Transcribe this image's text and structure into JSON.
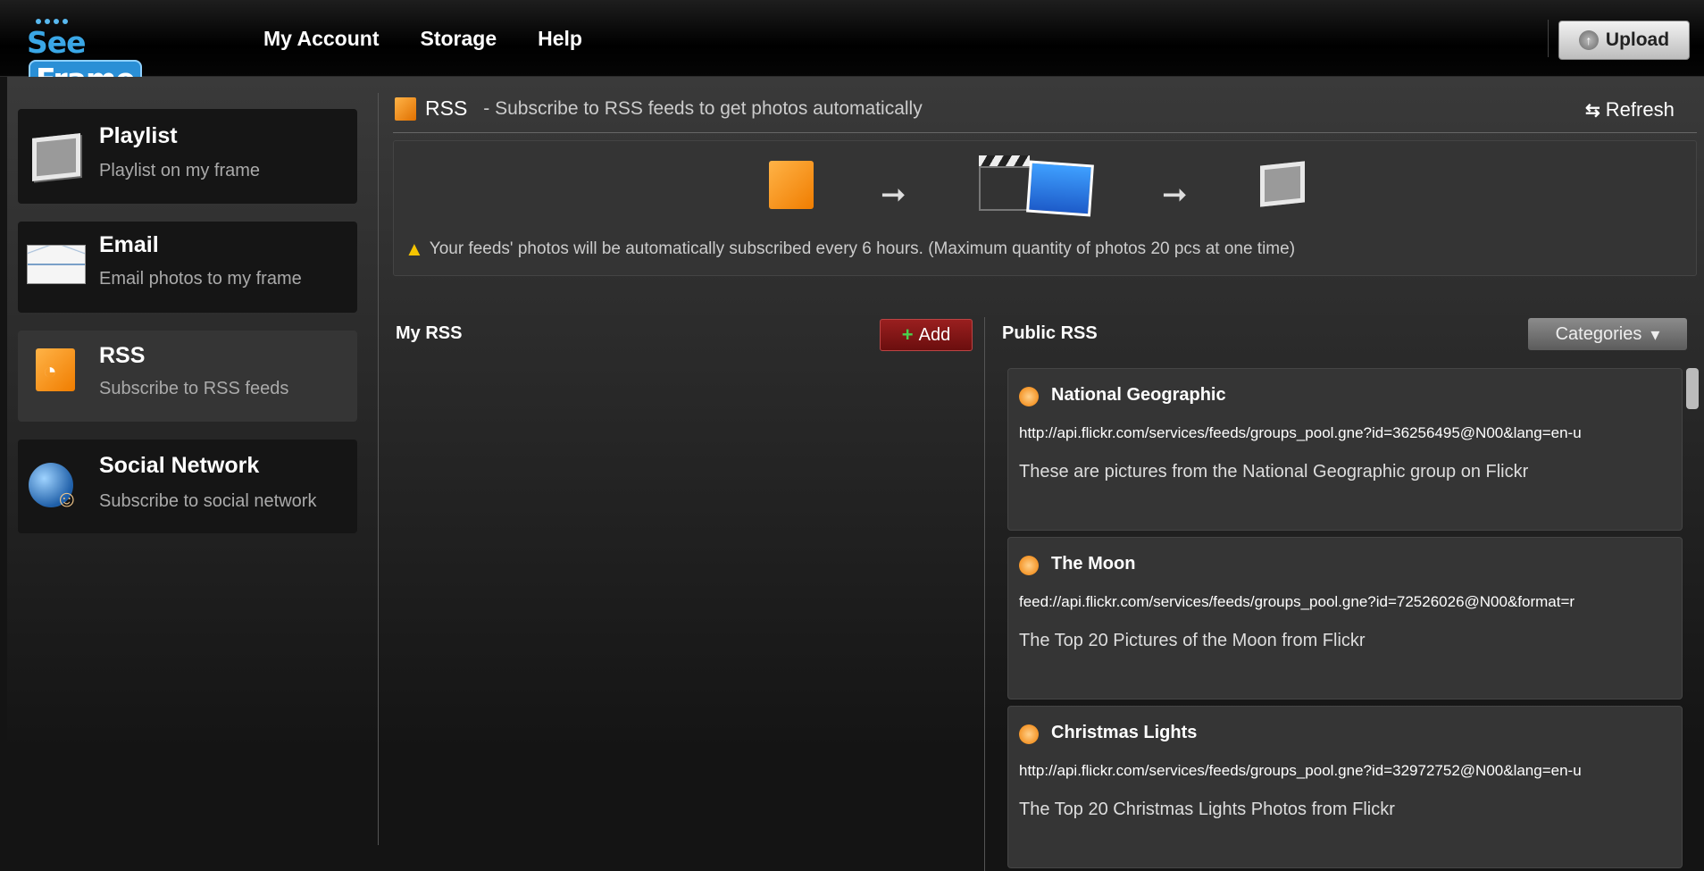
{
  "app": {
    "logo": "SeeFrame",
    "nav": [
      "My Account",
      "Storage",
      "Help"
    ],
    "upload_label": "Upload"
  },
  "sidebar": {
    "items": [
      {
        "title": "Playlist",
        "subtitle": "Playlist on my frame",
        "icon": "photo-frame-icon"
      },
      {
        "title": "Email",
        "subtitle": "Email photos to my frame",
        "icon": "envelope-icon"
      },
      {
        "title": "RSS",
        "subtitle": "Subscribe to RSS feeds",
        "icon": "rss-icon",
        "active": true
      },
      {
        "title": "Social Network",
        "subtitle": "Subscribe to social network",
        "icon": "globe-people-icon"
      }
    ]
  },
  "header": {
    "title": "RSS",
    "subtitle": "- Subscribe to RSS feeds to get photos automatically",
    "refresh_label": "Refresh"
  },
  "info": {
    "warning": "Your feeds' photos will be automatically subscribed every 6 hours. (Maximum quantity of photos 20 pcs at one time)"
  },
  "my_rss": {
    "title": "My RSS",
    "add_label": "Add"
  },
  "public_rss": {
    "title": "Public RSS",
    "categories_label": "Categories",
    "feeds": [
      {
        "title": "National Geographic",
        "url": "http://api.flickr.com/services/feeds/groups_pool.gne?id=36256495@N00&lang=en-u",
        "description": "These are pictures from the National Geographic group on Flickr"
      },
      {
        "title": "The Moon",
        "url": "feed://api.flickr.com/services/feeds/groups_pool.gne?id=72526026@N00&format=r",
        "description": "The Top 20 Pictures of the Moon from Flickr"
      },
      {
        "title": "Christmas Lights",
        "url": "http://api.flickr.com/services/feeds/groups_pool.gne?id=32972752@N00&lang=en-u",
        "description": "The Top 20 Christmas Lights Photos from Flickr"
      }
    ]
  },
  "colors": {
    "accent_rss": "#f07d00",
    "add_button": "#8a1a1a",
    "logo_blue": "#2a8fd6"
  }
}
